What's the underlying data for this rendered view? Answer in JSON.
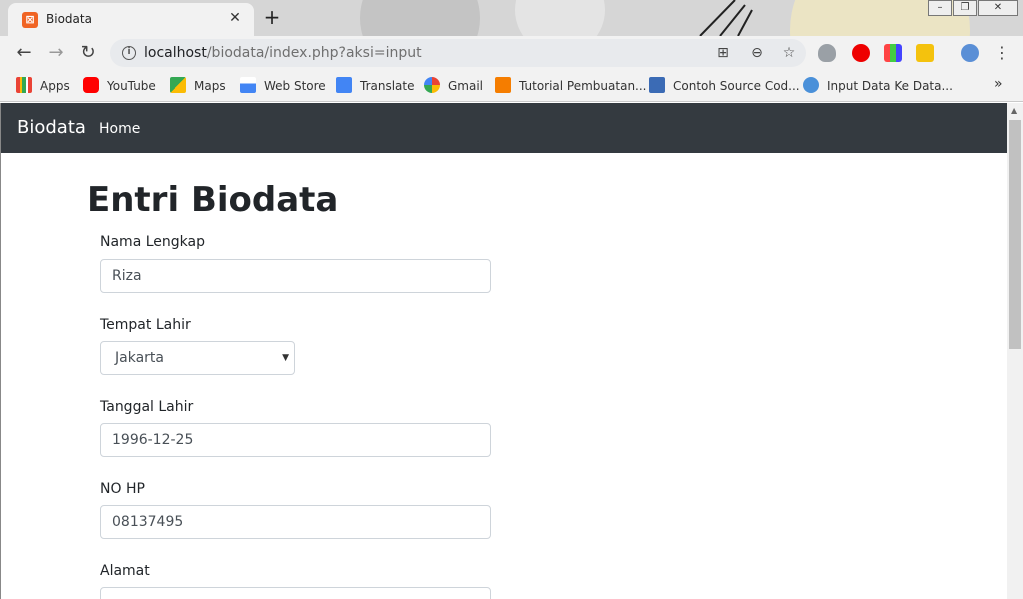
{
  "browser": {
    "tab_title": "Biodata",
    "tab_icon": "xampp-icon",
    "url_host": "localhost",
    "url_path": "/biodata/index.php?aksi=input",
    "bookmarks": [
      {
        "label": "Apps",
        "icon": "apps-grid-icon",
        "color": "#4285f4"
      },
      {
        "label": "YouTube",
        "icon": "youtube-icon",
        "color": "#ff0000"
      },
      {
        "label": "Maps",
        "icon": "maps-icon",
        "color": "#34a853"
      },
      {
        "label": "Web Store",
        "icon": "webstore-icon",
        "color": "#fbbc05"
      },
      {
        "label": "Translate",
        "icon": "translate-icon",
        "color": "#4285f4"
      },
      {
        "label": "Gmail",
        "icon": "google-icon",
        "color": "#ea4335"
      },
      {
        "label": "Tutorial Pembuatan...",
        "icon": "blogger-icon",
        "color": "#f57d00"
      },
      {
        "label": "Contoh Source Cod...",
        "icon": "kmw-icon",
        "color": "#3b6bb5"
      },
      {
        "label": "Input Data Ke Data...",
        "icon": "link-icon",
        "color": "#4a90d9"
      }
    ]
  },
  "navbar": {
    "brand": "Biodata",
    "home": "Home",
    "bg_color": "#343a40"
  },
  "page": {
    "title": "Entri Biodata",
    "fields": {
      "nama_label": "Nama Lengkap",
      "nama_value": "Riza",
      "tempat_label": "Tempat Lahir",
      "tempat_value": "Jakarta",
      "tanggal_label": "Tanggal Lahir",
      "tanggal_value": "1996-12-25",
      "hp_label": "NO HP",
      "hp_value": "08137495",
      "alamat_label": "Alamat",
      "alamat_value": ""
    }
  }
}
